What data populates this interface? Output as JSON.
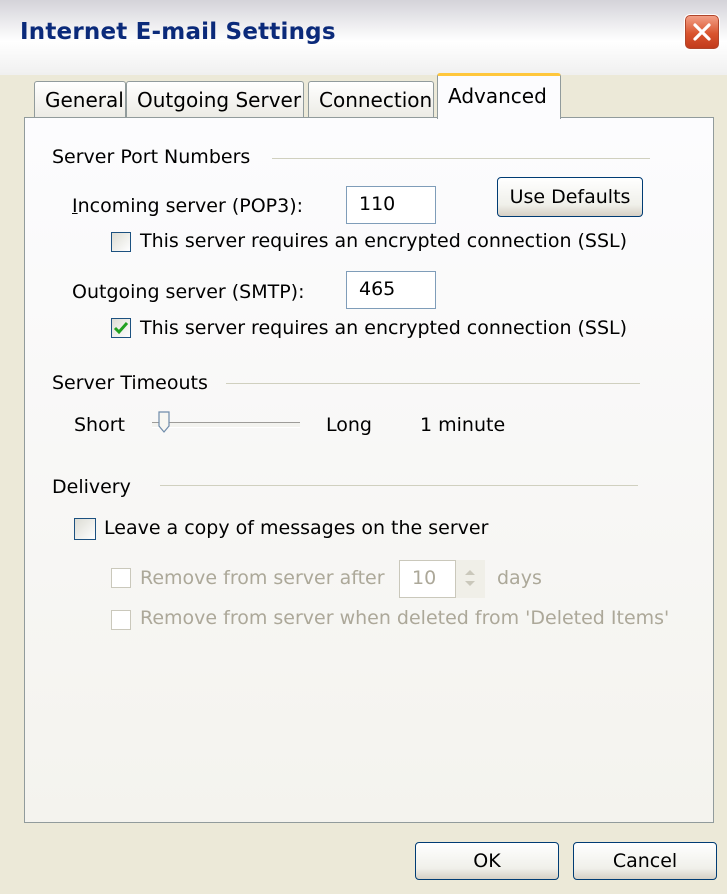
{
  "window": {
    "title": "Internet E-mail Settings"
  },
  "tabs": [
    {
      "label": "General"
    },
    {
      "label": "Outgoing Server"
    },
    {
      "label": "Connection"
    },
    {
      "label": "Advanced"
    }
  ],
  "active_tab": "Advanced",
  "ports": {
    "group_label": "Server Port Numbers",
    "incoming_label": "Incoming server (POP3):",
    "incoming_value": "110",
    "incoming_ssl_label": "This server requires an encrypted connection (SSL)",
    "incoming_ssl_checked": false,
    "use_defaults_label": "Use Defaults",
    "outgoing_label": "Outgoing server (SMTP):",
    "outgoing_value": "465",
    "outgoing_ssl_label": "This server requires an encrypted connection (SSL)",
    "outgoing_ssl_checked": true
  },
  "timeouts": {
    "group_label": "Server Timeouts",
    "short_label": "Short",
    "long_label": "Long",
    "value_text": "1 minute",
    "slider_level": 0.1
  },
  "delivery": {
    "group_label": "Delivery",
    "leave_copy_label": "Leave a copy of messages on the server",
    "leave_copy_checked": false,
    "remove_after_label": "Remove from server after",
    "remove_after_value": "10",
    "days_label": "days",
    "remove_deleted_label": "Remove from server when deleted from 'Deleted Items'"
  },
  "buttons": {
    "ok_label": "OK",
    "cancel_label": "Cancel"
  },
  "colors": {
    "accent_tab": "#ffc73c",
    "title_text": "#0b2a7a",
    "close_button": "#d9542e",
    "check_green": "#21a121"
  }
}
